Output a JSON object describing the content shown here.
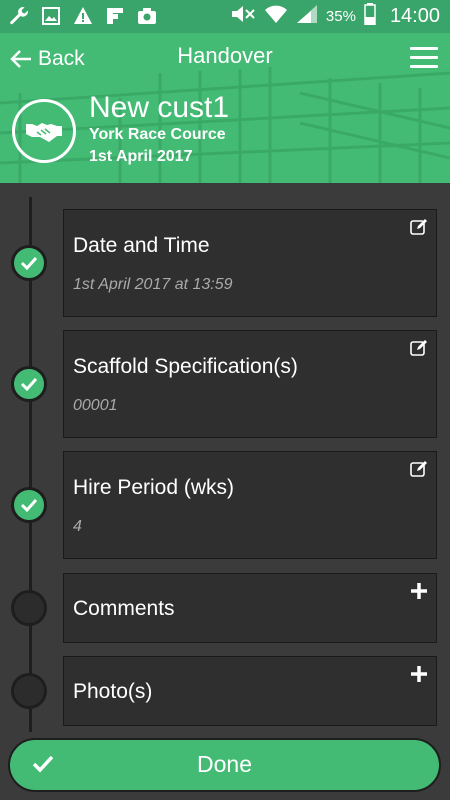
{
  "status_bar": {
    "icons_left": [
      "wrench-icon",
      "image-icon",
      "warning-icon",
      "flipboard-icon",
      "camera-icon"
    ],
    "icons_right": [
      "mute-icon",
      "wifi-icon",
      "signal-icon",
      "battery-icon"
    ],
    "battery": "35%",
    "time": "14:00"
  },
  "header": {
    "back_label": "Back",
    "title": "Handover",
    "customer_name": "New cust1",
    "location": "York Race Cource",
    "date": "1st April 2017",
    "accent": "#43bb75"
  },
  "steps": [
    {
      "title": "Date and Time",
      "value": "1st April 2017 at 13:59",
      "completed": true,
      "action": "edit-icon"
    },
    {
      "title": "Scaffold Specification(s)",
      "value": "00001",
      "completed": true,
      "action": "edit-icon"
    },
    {
      "title": "Hire Period (wks)",
      "value": "4",
      "completed": true,
      "action": "edit-icon"
    },
    {
      "title": "Comments",
      "value": "",
      "completed": false,
      "action": "plus-icon"
    },
    {
      "title": "Photo(s)",
      "value": "",
      "completed": false,
      "action": "plus-icon"
    }
  ],
  "done_button": {
    "label": "Done"
  }
}
